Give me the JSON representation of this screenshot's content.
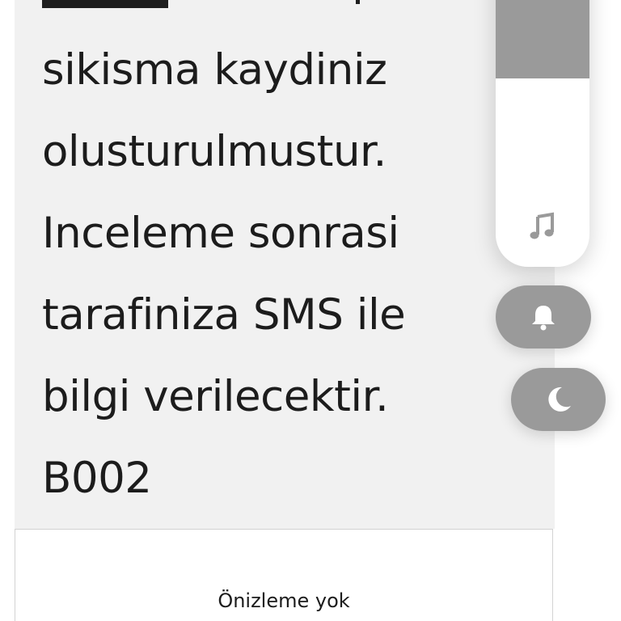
{
  "message": {
    "lines": [
      "sikisma kaydiniz",
      "olusturulmustur.",
      "Inceleme sonrasi",
      "tarafiniza SMS ile",
      "bilgi verilecektir.",
      "B002"
    ]
  },
  "preview": {
    "label": "Önizleme yok"
  },
  "volume": {
    "level_percent": 37,
    "media_icon": "music-note-icon",
    "ring_icon": "bell-icon",
    "dnd_icon": "moon-icon"
  },
  "colors": {
    "bubble": "#f1f1f1",
    "control_gray": "#9a9a9a",
    "text": "#1c1c1c"
  }
}
